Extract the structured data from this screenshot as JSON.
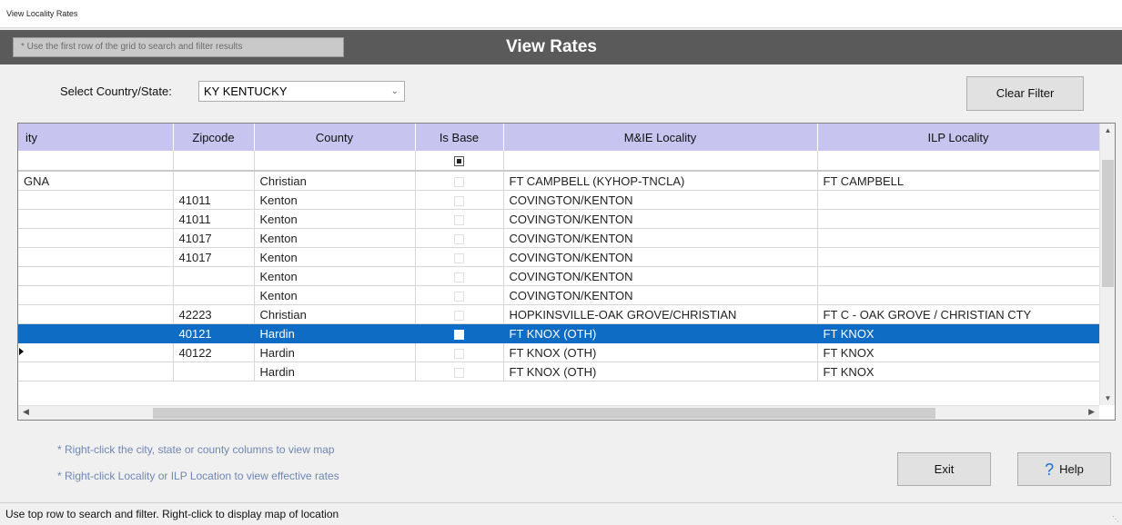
{
  "window": {
    "title": "View Locality Rates"
  },
  "header": {
    "hint": "* Use the first row of the grid to search and filter results",
    "title": "View Rates"
  },
  "filter": {
    "label": "Select Country/State:",
    "selected": "KY KENTUCKY"
  },
  "buttons": {
    "clear_filter": "Clear Filter",
    "exit": "Exit",
    "help": "Help"
  },
  "grid": {
    "columns": [
      "ity",
      "Zipcode",
      "County",
      "Is Base",
      "M&IE Locality",
      "ILP Locality"
    ],
    "rows": [
      {
        "city": "GNA",
        "zip": "",
        "county": "Christian",
        "is_base": false,
        "mie": "FT CAMPBELL (KYHOP-TNCLA)",
        "ilp": "FT CAMPBELL"
      },
      {
        "city": "",
        "zip": "41011",
        "county": "Kenton",
        "is_base": false,
        "mie": "COVINGTON/KENTON",
        "ilp": ""
      },
      {
        "city": "",
        "zip": "41011",
        "county": "Kenton",
        "is_base": false,
        "mie": "COVINGTON/KENTON",
        "ilp": ""
      },
      {
        "city": "",
        "zip": "41017",
        "county": "Kenton",
        "is_base": false,
        "mie": "COVINGTON/KENTON",
        "ilp": ""
      },
      {
        "city": "",
        "zip": "41017",
        "county": "Kenton",
        "is_base": false,
        "mie": "COVINGTON/KENTON",
        "ilp": ""
      },
      {
        "city": "",
        "zip": "",
        "county": "Kenton",
        "is_base": false,
        "mie": "COVINGTON/KENTON",
        "ilp": ""
      },
      {
        "city": "",
        "zip": "",
        "county": "Kenton",
        "is_base": false,
        "mie": "COVINGTON/KENTON",
        "ilp": ""
      },
      {
        "city": "",
        "zip": "42223",
        "county": "Christian",
        "is_base": false,
        "mie": "HOPKINSVILLE-OAK GROVE/CHRISTIAN",
        "ilp": "FT C - OAK GROVE / CHRISTIAN CTY"
      },
      {
        "city": "",
        "zip": "40121",
        "county": "Hardin",
        "is_base": false,
        "mie": "FT KNOX  (OTH)",
        "ilp": "FT KNOX",
        "selected": true
      },
      {
        "city": "",
        "zip": "40122",
        "county": "Hardin",
        "is_base": false,
        "mie": "FT KNOX  (OTH)",
        "ilp": "FT KNOX"
      },
      {
        "city": "",
        "zip": "",
        "county": "Hardin",
        "is_base": false,
        "mie": "FT KNOX  (OTH)",
        "ilp": "FT KNOX"
      }
    ]
  },
  "notes": {
    "map": "* Right-click the city, state or county columns to view map",
    "rates": "* Right-click Locality or ILP Location to view effective rates"
  },
  "status": {
    "text": "Use top row to search and filter. Right-click to display map of location"
  },
  "colors": {
    "header_band": "#5a5a5a",
    "column_header": "#c7c5ef",
    "selection": "#0f6cc4",
    "note_text": "#6f87b2"
  }
}
